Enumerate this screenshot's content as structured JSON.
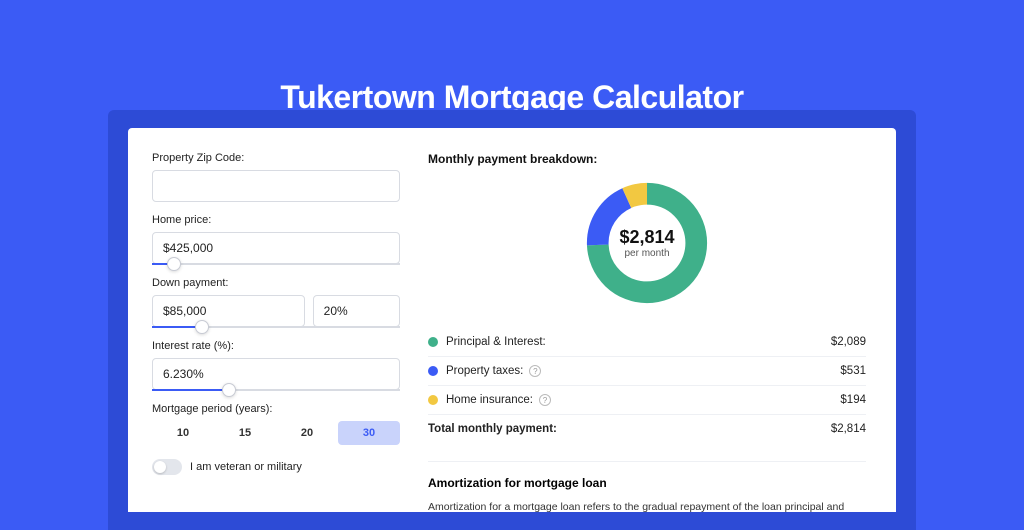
{
  "page": {
    "title": "Tukertown Mortgage Calculator"
  },
  "form": {
    "zip_label": "Property Zip Code:",
    "zip_value": "",
    "home_price_label": "Home price:",
    "home_price_value": "$425,000",
    "home_price_slider_pct": 9,
    "down_payment_label": "Down payment:",
    "down_payment_value": "$85,000",
    "down_payment_pct_value": "20%",
    "down_payment_slider_pct": 20,
    "interest_label": "Interest rate (%):",
    "interest_value": "6.230%",
    "interest_slider_pct": 31,
    "period_label": "Mortgage period (years):",
    "periods": [
      {
        "label": "10",
        "active": false
      },
      {
        "label": "15",
        "active": false
      },
      {
        "label": "20",
        "active": false
      },
      {
        "label": "30",
        "active": true
      }
    ],
    "veteran_label": "I am veteran or military"
  },
  "breakdown": {
    "title": "Monthly payment breakdown:",
    "donut_amount": "$2,814",
    "donut_sub": "per month",
    "rows": [
      {
        "label": "Principal & Interest:",
        "value": "$2,089",
        "color": "#3fb08a",
        "help": false
      },
      {
        "label": "Property taxes:",
        "value": "$531",
        "color": "#3b5bf5",
        "help": true
      },
      {
        "label": "Home insurance:",
        "value": "$194",
        "color": "#f2c841",
        "help": true
      }
    ],
    "total_label": "Total monthly payment:",
    "total_value": "$2,814"
  },
  "amort": {
    "title": "Amortization for mortgage loan",
    "text": "Amortization for a mortgage loan refers to the gradual repayment of the loan principal and interest over a specified"
  },
  "chart_data": {
    "type": "pie",
    "title": "Monthly payment breakdown",
    "series": [
      {
        "name": "Principal & Interest",
        "value": 2089,
        "color": "#3fb08a"
      },
      {
        "name": "Property taxes",
        "value": 531,
        "color": "#3b5bf5"
      },
      {
        "name": "Home insurance",
        "value": 194,
        "color": "#f2c841"
      }
    ],
    "total": 2814,
    "center_label": "$2,814 per month"
  }
}
